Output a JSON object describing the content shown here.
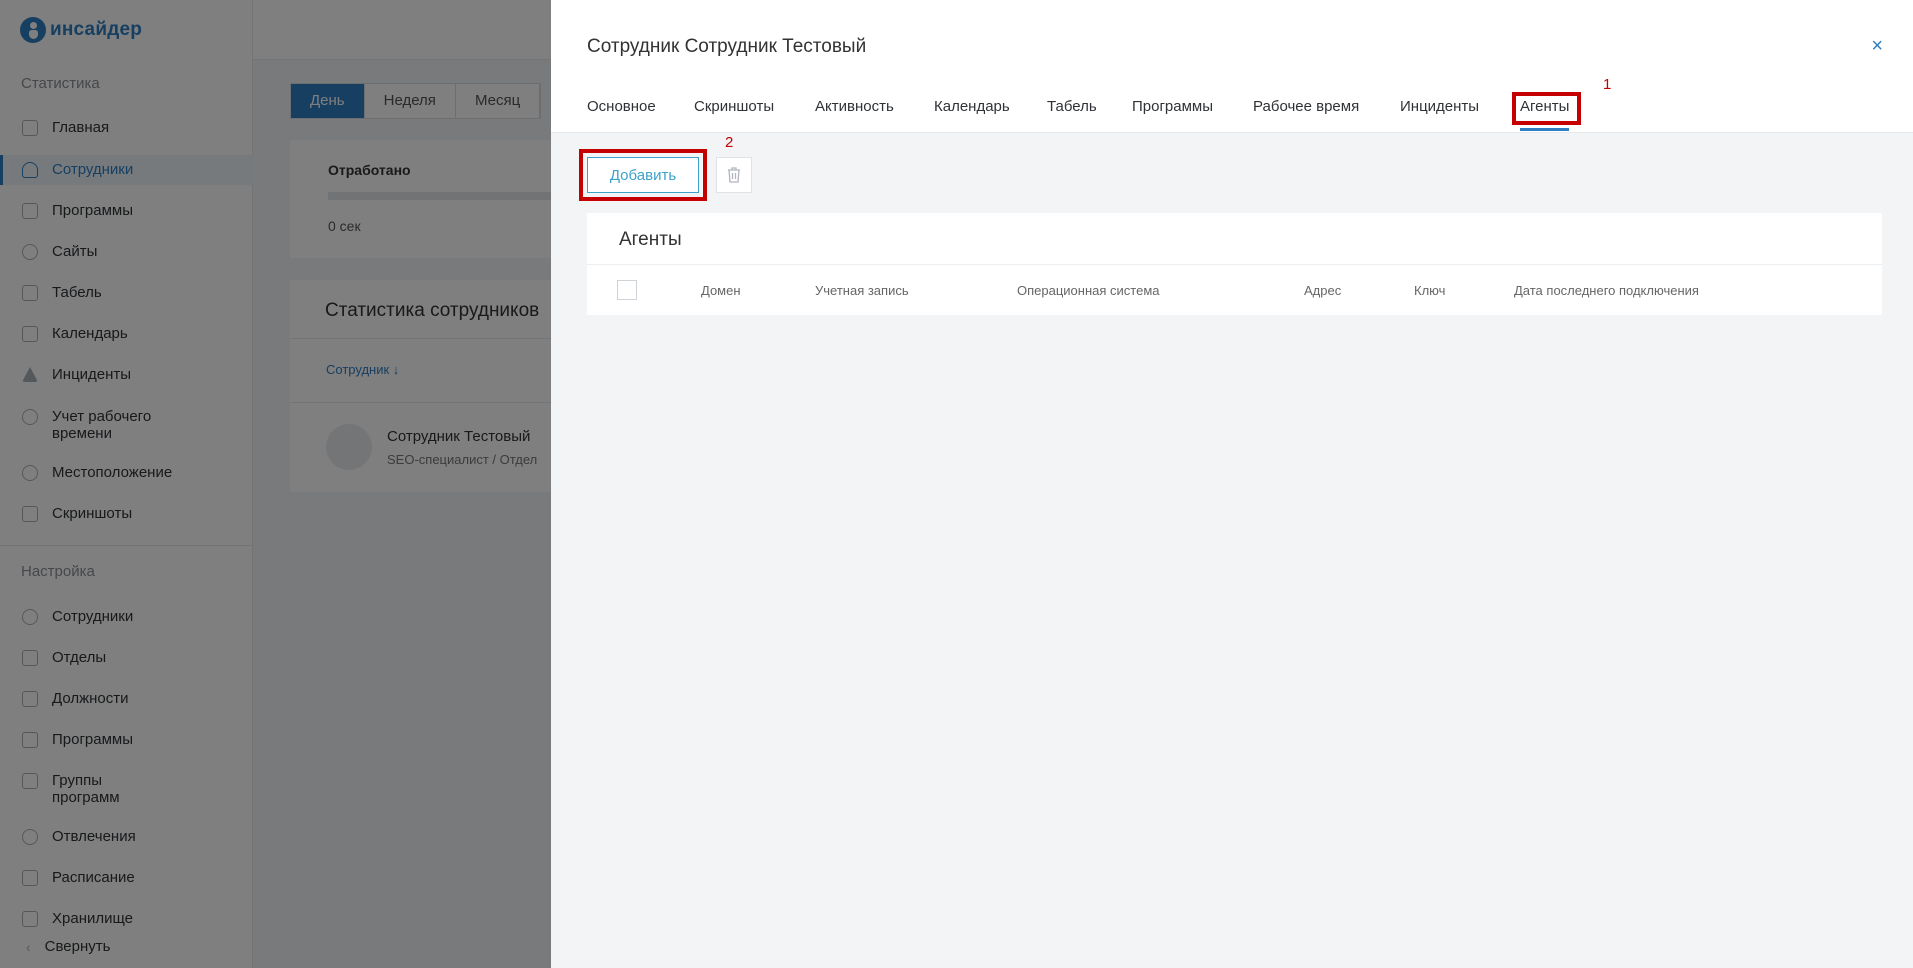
{
  "sidebar": {
    "logo": "инсайдер",
    "section_stats": "Статистика",
    "stats_items": [
      {
        "label": "Главная",
        "icon": "dashboard-icon"
      },
      {
        "label": "Сотрудники",
        "icon": "user-icon"
      },
      {
        "label": "Программы",
        "icon": "apps-icon"
      },
      {
        "label": "Сайты",
        "icon": "globe-icon"
      },
      {
        "label": "Табель",
        "icon": "table-icon"
      },
      {
        "label": "Календарь",
        "icon": "calendar-icon"
      },
      {
        "label": "Инциденты",
        "icon": "warning-icon"
      },
      {
        "label": "Учет рабочего времени",
        "icon": "stopwatch-icon"
      },
      {
        "label": "Местоположение",
        "icon": "location-icon"
      },
      {
        "label": "Скриншоты",
        "icon": "screenshot-icon"
      }
    ],
    "section_settings": "Настройка",
    "settings_items": [
      {
        "label": "Сотрудники",
        "icon": "user-icon"
      },
      {
        "label": "Отделы",
        "icon": "building-icon"
      },
      {
        "label": "Должности",
        "icon": "badge-icon"
      },
      {
        "label": "Программы",
        "icon": "apps-icon"
      },
      {
        "label": "Группы программ",
        "icon": "grid-icon"
      },
      {
        "label": "Отвлечения",
        "icon": "distraction-icon"
      },
      {
        "label": "Расписание",
        "icon": "schedule-icon"
      },
      {
        "label": "Хранилище",
        "icon": "storage-icon"
      }
    ],
    "collapse": "Свернуть"
  },
  "background": {
    "periods": [
      "День",
      "Неделя",
      "Месяц"
    ],
    "worked_title": "Отработано",
    "worked_value": "0 сек",
    "stats_title": "Статистика сотрудников",
    "col_employee": "Сотрудник ↓",
    "employee_name": "Сотрудник Тестовый",
    "employee_sub": "SEO-специалист / Отдел"
  },
  "modal": {
    "title": "Сотрудник Сотрудник Тестовый",
    "close": "×",
    "tabs": [
      "Основное",
      "Скриншоты",
      "Активность",
      "Календарь",
      "Табель",
      "Программы",
      "Рабочее время",
      "Инциденты",
      "Агенты"
    ],
    "active_tab": "Агенты",
    "annotation_1": "1",
    "annotation_2": "2",
    "add_button": "Добавить",
    "table": {
      "title": "Агенты",
      "columns": [
        "Домен",
        "Учетная запись",
        "Операционная система",
        "Адрес",
        "Ключ",
        "Дата последнего подключения"
      ]
    }
  },
  "colors": {
    "accent": "#2e7fc2",
    "highlight": "#c40000",
    "button_text": "#3da2c9"
  }
}
